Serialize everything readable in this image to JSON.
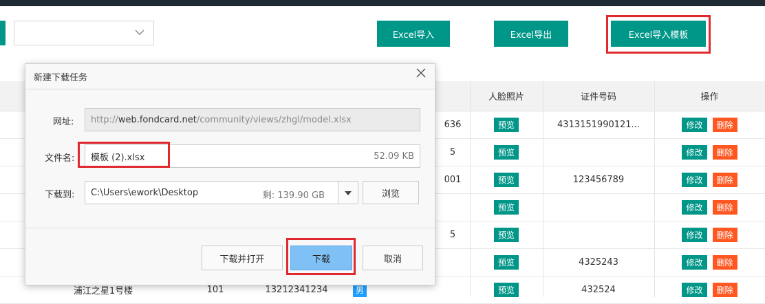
{
  "toolbar": {
    "import_label": "Excel导入",
    "export_label": "Excel导出",
    "template_label": "Excel导入模板"
  },
  "table": {
    "headers": {
      "face_photo": "人脸照片",
      "id_number": "证件号码",
      "actions": "操作"
    },
    "partial_col": [
      "636",
      "5",
      "001",
      "",
      "5",
      "",
      ""
    ],
    "preview_label": "预览",
    "edit_label": "修改",
    "delete_label": "删除",
    "id_numbers": [
      "4313151990121...",
      "",
      "123456789",
      "",
      "",
      "4325243",
      "432524"
    ],
    "last_row": {
      "building": "浦江之星1号楼",
      "room": "101",
      "phone": "13212341234",
      "gender": "男"
    }
  },
  "dialog": {
    "title": "新建下载任务",
    "url_label": "网址:",
    "url_prefix": "http://",
    "url_host": "web.fondcard.net",
    "url_path": "/community/views/zhgl/model.xlsx",
    "filename_label": "文件名:",
    "filename": "模板 (2).xlsx",
    "filesize": "52.09 KB",
    "saveto_label": "下载到:",
    "save_path": "C:\\Users\\ework\\Desktop",
    "free_space": "剩: 139.90 GB",
    "browse_label": "浏览",
    "download_open_label": "下载并打开",
    "download_label": "下载",
    "cancel_label": "取消"
  },
  "colors": {
    "primary": "#009688",
    "danger": "#ff5722",
    "highlight": "#e0282e",
    "blue": "#1e9fff"
  }
}
